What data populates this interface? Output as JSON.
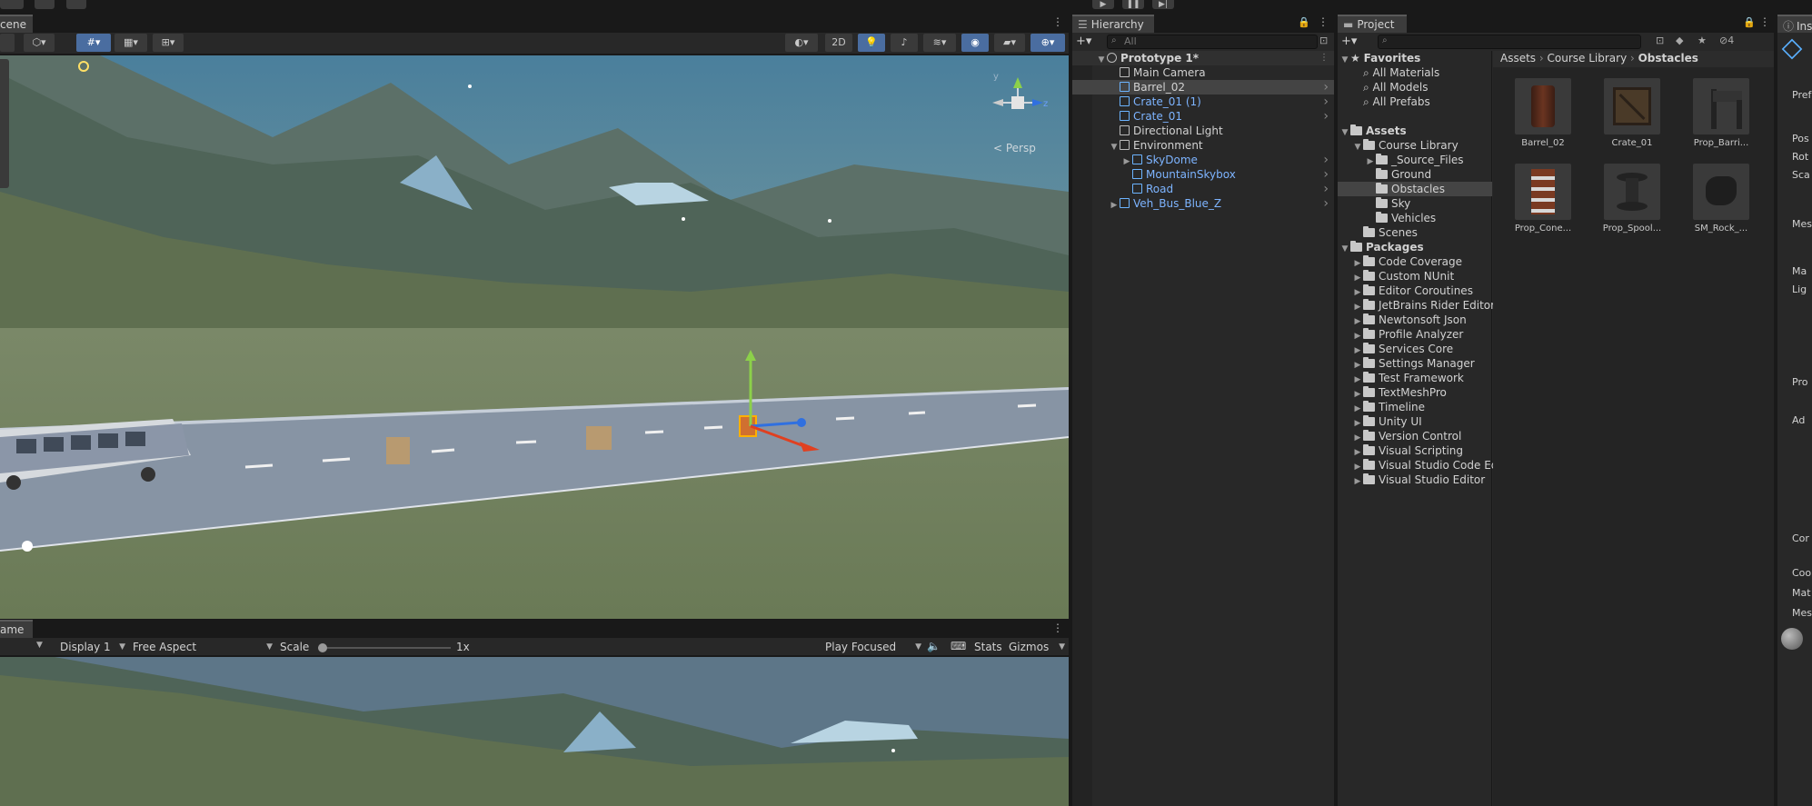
{
  "top": {
    "play_icon": "play-icon",
    "pause_icon": "pause-icon",
    "step_icon": "step-icon"
  },
  "scene": {
    "tab_label": "cene",
    "btn_2d": "2D",
    "persp_label": "< Persp",
    "gizmo_axes": {
      "y": "y",
      "z": "z"
    }
  },
  "game": {
    "tab_label": "ame",
    "display": "Display 1",
    "aspect": "Free Aspect",
    "scale_label": "Scale",
    "scale_value": "1x",
    "play_mode": "Play Focused",
    "stats": "Stats",
    "gizmos": "Gizmos"
  },
  "hierarchy": {
    "tab_label": "Hierarchy",
    "search_placeholder": "All",
    "items": [
      {
        "label": "Prototype 1*",
        "indent": 0,
        "kind": "scene",
        "fold": "open",
        "blue": false,
        "arrow": false,
        "selected": false
      },
      {
        "label": "Main Camera",
        "indent": 1,
        "kind": "obj",
        "fold": "",
        "blue": false,
        "arrow": false,
        "selected": false
      },
      {
        "label": "Barrel_02",
        "indent": 1,
        "kind": "prefab",
        "fold": "",
        "blue": false,
        "arrow": true,
        "selected": true
      },
      {
        "label": "Crate_01 (1)",
        "indent": 1,
        "kind": "prefab",
        "fold": "",
        "blue": true,
        "arrow": true,
        "selected": false
      },
      {
        "label": "Crate_01",
        "indent": 1,
        "kind": "prefab",
        "fold": "",
        "blue": true,
        "arrow": true,
        "selected": false
      },
      {
        "label": "Directional Light",
        "indent": 1,
        "kind": "obj",
        "fold": "",
        "blue": false,
        "arrow": false,
        "selected": false
      },
      {
        "label": "Environment",
        "indent": 1,
        "kind": "obj",
        "fold": "open",
        "blue": false,
        "arrow": false,
        "selected": false
      },
      {
        "label": "SkyDome",
        "indent": 2,
        "kind": "prefab",
        "fold": "closed",
        "blue": true,
        "arrow": true,
        "selected": false
      },
      {
        "label": "MountainSkybox",
        "indent": 2,
        "kind": "prefab",
        "fold": "",
        "blue": true,
        "arrow": true,
        "selected": false
      },
      {
        "label": "Road",
        "indent": 2,
        "kind": "prefab",
        "fold": "",
        "blue": true,
        "arrow": true,
        "selected": false
      },
      {
        "label": "Veh_Bus_Blue_Z",
        "indent": 1,
        "kind": "prefab",
        "fold": "closed",
        "blue": true,
        "arrow": true,
        "selected": false
      }
    ]
  },
  "project": {
    "tab_label": "Project",
    "hidden_count": "4",
    "breadcrumb": [
      "Assets",
      "Course Library",
      "Obstacles"
    ],
    "tree": [
      {
        "label": "Favorites",
        "indent": 0,
        "kind": "star",
        "fold": "open",
        "bold": true
      },
      {
        "label": "All Materials",
        "indent": 1,
        "kind": "search",
        "fold": "",
        "bold": false
      },
      {
        "label": "All Models",
        "indent": 1,
        "kind": "search",
        "fold": "",
        "bold": false
      },
      {
        "label": "All Prefabs",
        "indent": 1,
        "kind": "search",
        "fold": "",
        "bold": false
      },
      {
        "label": "",
        "indent": 0,
        "kind": "gap",
        "fold": "",
        "bold": false
      },
      {
        "label": "Assets",
        "indent": 0,
        "kind": "folder",
        "fold": "open",
        "bold": true
      },
      {
        "label": "Course Library",
        "indent": 1,
        "kind": "folder",
        "fold": "open",
        "bold": false
      },
      {
        "label": "_Source_Files",
        "indent": 2,
        "kind": "folder",
        "fold": "closed",
        "bold": false
      },
      {
        "label": "Ground",
        "indent": 2,
        "kind": "folder",
        "fold": "",
        "bold": false
      },
      {
        "label": "Obstacles",
        "indent": 2,
        "kind": "folder",
        "fold": "",
        "bold": false,
        "selected": true
      },
      {
        "label": "Sky",
        "indent": 2,
        "kind": "folder",
        "fold": "",
        "bold": false
      },
      {
        "label": "Vehicles",
        "indent": 2,
        "kind": "folder",
        "fold": "",
        "bold": false
      },
      {
        "label": "Scenes",
        "indent": 1,
        "kind": "folder",
        "fold": "",
        "bold": false
      },
      {
        "label": "Packages",
        "indent": 0,
        "kind": "folder",
        "fold": "open",
        "bold": true
      },
      {
        "label": "Code Coverage",
        "indent": 1,
        "kind": "folder",
        "fold": "closed",
        "bold": false
      },
      {
        "label": "Custom NUnit",
        "indent": 1,
        "kind": "folder",
        "fold": "closed",
        "bold": false
      },
      {
        "label": "Editor Coroutines",
        "indent": 1,
        "kind": "folder",
        "fold": "closed",
        "bold": false
      },
      {
        "label": "JetBrains Rider Editor",
        "indent": 1,
        "kind": "folder",
        "fold": "closed",
        "bold": false
      },
      {
        "label": "Newtonsoft Json",
        "indent": 1,
        "kind": "folder",
        "fold": "closed",
        "bold": false
      },
      {
        "label": "Profile Analyzer",
        "indent": 1,
        "kind": "folder",
        "fold": "closed",
        "bold": false
      },
      {
        "label": "Services Core",
        "indent": 1,
        "kind": "folder",
        "fold": "closed",
        "bold": false
      },
      {
        "label": "Settings Manager",
        "indent": 1,
        "kind": "folder",
        "fold": "closed",
        "bold": false
      },
      {
        "label": "Test Framework",
        "indent": 1,
        "kind": "folder",
        "fold": "closed",
        "bold": false
      },
      {
        "label": "TextMeshPro",
        "indent": 1,
        "kind": "folder",
        "fold": "closed",
        "bold": false
      },
      {
        "label": "Timeline",
        "indent": 1,
        "kind": "folder",
        "fold": "closed",
        "bold": false
      },
      {
        "label": "Unity UI",
        "indent": 1,
        "kind": "folder",
        "fold": "closed",
        "bold": false
      },
      {
        "label": "Version Control",
        "indent": 1,
        "kind": "folder",
        "fold": "closed",
        "bold": false
      },
      {
        "label": "Visual Scripting",
        "indent": 1,
        "kind": "folder",
        "fold": "closed",
        "bold": false
      },
      {
        "label": "Visual Studio Code Ed",
        "indent": 1,
        "kind": "folder",
        "fold": "closed",
        "bold": false
      },
      {
        "label": "Visual Studio Editor",
        "indent": 1,
        "kind": "folder",
        "fold": "closed",
        "bold": false
      }
    ],
    "assets": [
      {
        "label": "Barrel_02",
        "thumb": "barrel"
      },
      {
        "label": "Crate_01",
        "thumb": "crate"
      },
      {
        "label": "Prop_Barri...",
        "thumb": "barrier"
      },
      {
        "label": "Prop_Cone...",
        "thumb": "cone"
      },
      {
        "label": "Prop_Spool...",
        "thumb": "spool"
      },
      {
        "label": "SM_Rock_...",
        "thumb": "rock"
      }
    ]
  },
  "inspector": {
    "tab_label": "Ins",
    "rows": [
      "Pref",
      "Pos",
      "Rot",
      "Sca",
      "Mes",
      "Ma",
      "Lig",
      "Pro",
      "Ad",
      "Cor",
      "Coo",
      "Mat",
      "Mes"
    ]
  }
}
